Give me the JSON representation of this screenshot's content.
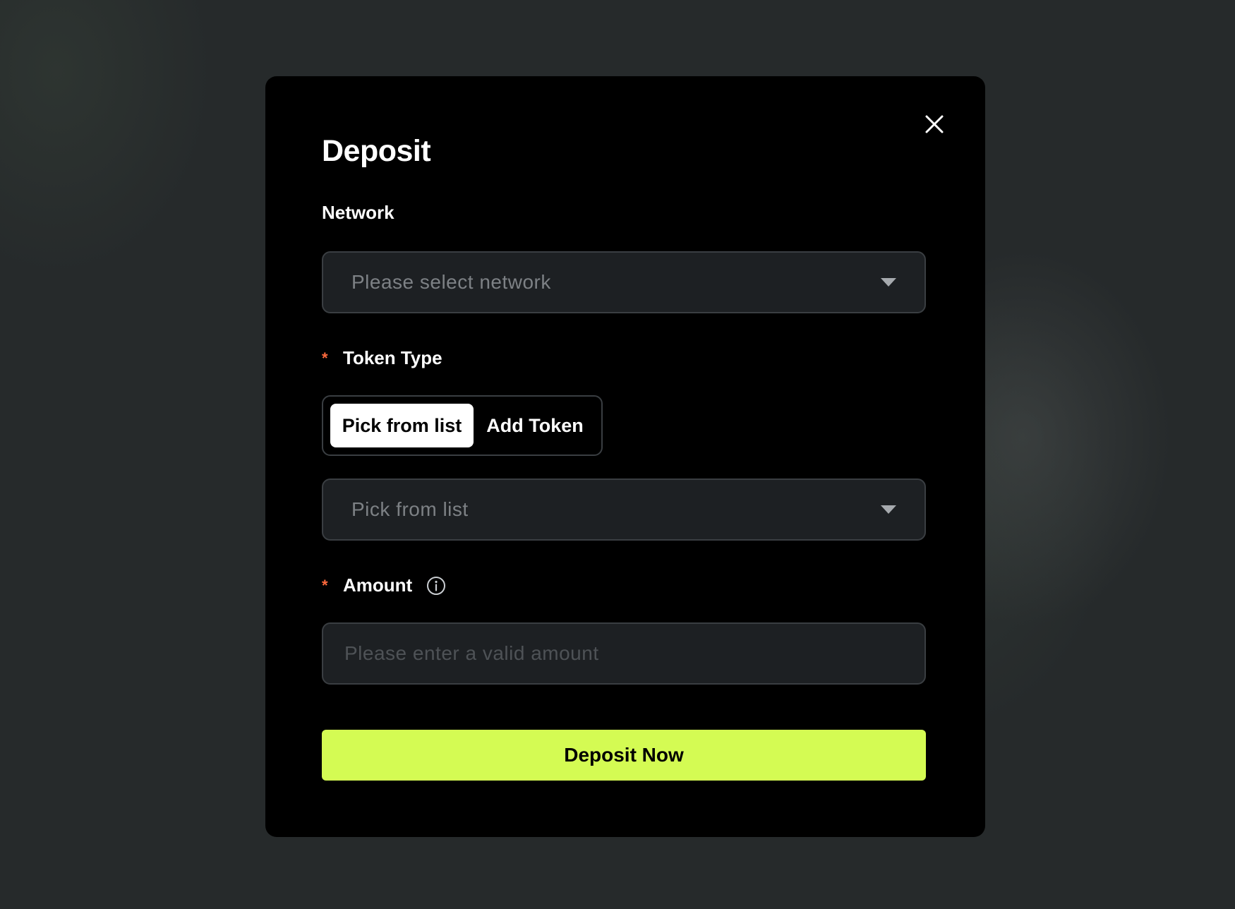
{
  "modal": {
    "title": "Deposit",
    "close_icon": "close-icon"
  },
  "network": {
    "label": "Network",
    "placeholder": "Please select network",
    "dropdown_icon": "caret-down-icon"
  },
  "token_type": {
    "required_mark": "*",
    "label": "Token Type",
    "tabs": [
      {
        "label": "Pick from list",
        "selected": true
      },
      {
        "label": "Add Token",
        "selected": false
      }
    ],
    "select_placeholder": "Pick from list",
    "dropdown_icon": "caret-down-icon"
  },
  "amount": {
    "required_mark": "*",
    "label": "Amount",
    "info_icon": "info-icon",
    "placeholder": "Please enter a valid amount"
  },
  "actions": {
    "submit_label": "Deposit Now"
  },
  "colors": {
    "accent": "#d4fb53",
    "required": "#ff6a3d",
    "modal_background": "#000000",
    "page_background": "#262a2b"
  }
}
